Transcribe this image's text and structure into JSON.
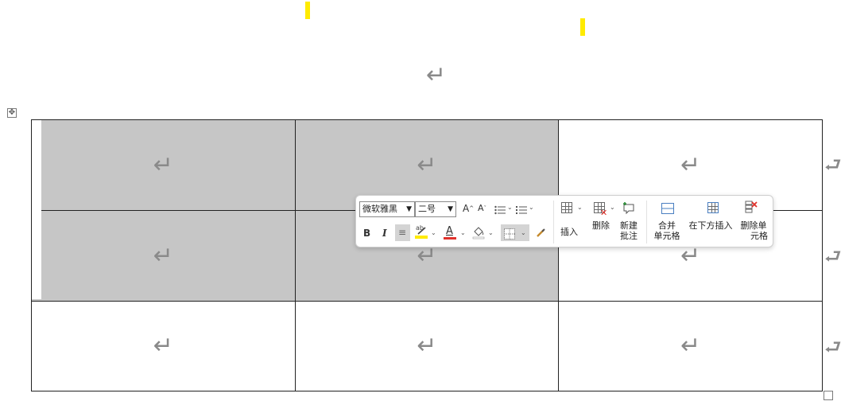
{
  "document": {
    "paragraph_mark": "↵",
    "row_end_mark": "⮐",
    "move_handle_glyph": "✥",
    "table": {
      "rows": [
        [
          "↵",
          "↵",
          "↵"
        ],
        [
          "↵",
          "↵",
          "↵"
        ],
        [
          "↵",
          "↵",
          "↵"
        ]
      ],
      "selected_cells": [
        [
          0,
          0
        ],
        [
          0,
          1
        ],
        [
          1,
          0
        ],
        [
          1,
          1
        ]
      ]
    }
  },
  "mini_toolbar": {
    "font_name": "微软雅黑",
    "font_size": "二号",
    "dropdown_caret": "▼",
    "grow_font": "A",
    "shrink_font": "A",
    "bold": "B",
    "italic": "I",
    "align": "≡",
    "highlight": "ab",
    "font_color": "A",
    "insert_label": "插入",
    "delete_label": "删除",
    "new_comment_line1": "新建",
    "new_comment_line2": "批注",
    "merge_line1": "合并",
    "merge_line2": "单元格",
    "insert_below_label": "在下方插入",
    "delete_cell_line1": "删除单",
    "delete_cell_line2": "元格",
    "colors": {
      "highlight_color": "#ffeb00",
      "font_color": "#e0312b",
      "accent": "#e0312b"
    }
  }
}
